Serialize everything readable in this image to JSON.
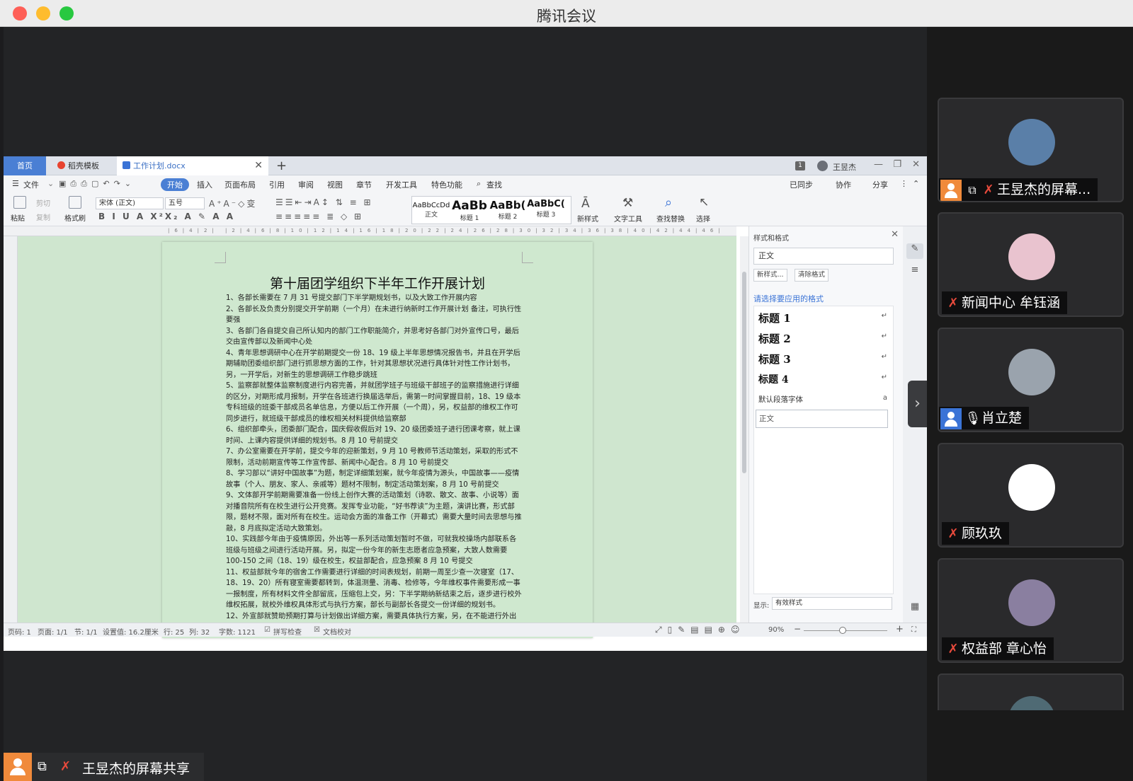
{
  "app": {
    "title": "腾讯会议"
  },
  "wps": {
    "tabs": [
      {
        "label": "首页"
      },
      {
        "label": "稻壳模板"
      },
      {
        "label": "工作计划.docx"
      }
    ],
    "user_name": "王昱杰",
    "badge": "1",
    "menu": [
      "文件",
      "开始",
      "插入",
      "页面布局",
      "引用",
      "审阅",
      "视图",
      "章节",
      "开发工具",
      "特色功能",
      "查找"
    ],
    "menu_right": [
      "已同步",
      "协作",
      "分享"
    ],
    "ribbon": {
      "paste": "粘贴",
      "cut": "剪切",
      "copy": "复制",
      "format_painter": "格式刷",
      "font_name": "宋体 (正文)",
      "font_size": "五号",
      "styles": [
        {
          "sample": "AaBbCcDd",
          "name": "正文"
        },
        {
          "sample": "AaBb",
          "name": "标题 1"
        },
        {
          "sample": "AaBb(",
          "name": "标题 2"
        },
        {
          "sample": "AaBbC(",
          "name": "标题 3"
        }
      ],
      "new_style": "新样式",
      "text_tools": "文字工具",
      "find_replace": "查找替换",
      "select": "选择"
    },
    "document": {
      "title": "第十届团学组织下半年工作开展计划",
      "paragraphs": [
        "1、各部长需要在 7 月 31 号提交部门下半学期规划书，以及大致工作开展内容",
        "2、各部长及负责分别提交开学前期（一个月）在未进行纳新时工作开展计划 备注，可执行性要强",
        "3、各部门各自提交自己所认知内的部门工作职能简介，并思考好各部门对外宣传口号，最后交由宣传部以及新闻中心处",
        "4、青年思想调研中心在开学前期提交一份 18、19 级上半年思想情况报告书，并且在开学后期辅助团委组织部门进行抓思想方面的工作，针对其思想状况进行具体针对性工作计划书，另，一开学后，对新生的思想调研工作稳步跳班",
        "5、监察部就整体监察制度进行内容完善，并就团学班子与班级干部班子的监察措施进行详细的区分，对期形成月报制，开学在各班进行换届选举后，需第一时间掌握目前，18、19 级本专科班级的班委干部成员名单信息，方便以后工作开展（一个周），另，权益部的维权工作可同步进行，就班级干部成员的维权相关材料提供给监察部",
        "6、组织部牵头，团委部门配合，国庆假收假后对 19、20 级团委班子进行团课考察，就上课时间、上课内容提供详细的规划书。8 月 10 号前提交",
        "7、办公室需要在开学前，提交今年的迎新策划，9 月 10 号教师节活动策划，采取的形式不限制，活动前期宣传等工作宣传部、新闻中心配合。8 月 10 号前提交",
        "8、学习部以“讲好中国故事”为题，制定详细策划案，就今年疫情为源头，中国故事——疫情故事（个人、朋友、家人、亲戚等）题材不限制，制定活动策划案，8 月 10 号前提交",
        "9、文体部开学前期需要准备一份线上创作大赛的活动策划（诗歌、散文、故事、小说等）面对播音院所有在校生进行公开竞赛。发挥专业功能，“好书荐读”为主题，演讲比赛，形式部限，题材不限，面对所有在校生。运动会方面的准备工作（开幕式）需要大量时间去思想与推敲，8 月底拟定活动大致策划。",
        "10、实践部今年由于疫情原因，外出等一系列活动策划暂时不做，可就我校操场内部联系各班级与班级之间进行活动开展。另，拟定一份今年的新生志愿者应急预案，大致人数需要 100-150 之间（18、19）级在校生，权益部配合，应急预案 8 月 10 号提交",
        "11、权益部就今年的宿舍工作需要进行详细的时间表规划，前期一周至少查一次寝室（17、18、19、20）所有寝室需要都转到，体温测量、消毒、检修等，今年维权事件需要形成一事一报制度，所有材料文件全部留底，压缩包上交，另：下半学期纳新结束之后，逐步进行校外维权拓展，就校外维权具体形式与执行方案，部长与副部长各提交一份详细的规划书。",
        "12、外宣部就赞助预期打算与计划做出详细方案，需要具体执行方案，另，在不能进行外出"
      ]
    },
    "style_panel": {
      "title": "样式和格式",
      "current": "正文",
      "new_style_btn": "新样式...",
      "clear_btn": "清除格式",
      "hint": "请选择要应用的格式",
      "items": [
        "标题 1",
        "标题 2",
        "标题 3",
        "标题 4"
      ],
      "default_font": "默认段落字体",
      "normal": "正文",
      "show_label": "显示:",
      "show_value": "有效样式"
    },
    "status": {
      "page": "页码: 1",
      "pages": "页面: 1/1",
      "section": "节: 1/1",
      "setting": "设置值: 16.2厘米",
      "row": "行: 25",
      "col": "列: 32",
      "words": "字数: 1121",
      "spell": "拼写检查",
      "proof": "文档校对",
      "zoom": "90%"
    }
  },
  "share_bar": {
    "text": "王昱杰的屏幕共享"
  },
  "participants": [
    {
      "name": "王昱杰的屏幕...",
      "avatar_color": "#5a7fa8"
    },
    {
      "name": "新闻中心 牟钰涵",
      "avatar_color": "#e9c3cf"
    },
    {
      "name": "肖立楚",
      "avatar_color": "#9aa3ad"
    },
    {
      "name": "顾玖玖",
      "avatar_color": "#ffffff"
    },
    {
      "name": "权益部   章心怡",
      "avatar_color": "#8a7fa0"
    }
  ]
}
